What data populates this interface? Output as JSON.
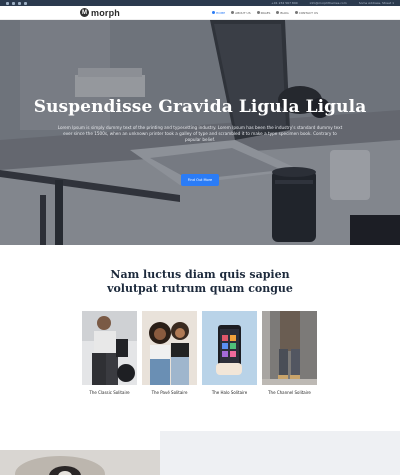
{
  "topbar": {
    "phone": "+01 234 567 890",
    "email": "info@morphthemes.com",
    "address": "Some Address, Street 1"
  },
  "brand": {
    "name": "morph",
    "mark": "M"
  },
  "nav": {
    "items": [
      {
        "label": "HOME",
        "active": true
      },
      {
        "label": "ABOUT US",
        "active": false
      },
      {
        "label": "PAGES",
        "active": false
      },
      {
        "label": "BLOG",
        "active": false
      },
      {
        "label": "CONTACT US",
        "active": false
      }
    ]
  },
  "hero": {
    "title": "Suspendisse Gravida Ligula Ligula",
    "text": "Lorem Ipsum is simply dummy text of the printing and typesetting industry. Lorem Ipsum has been the industry's standard dummy text ever since the 1500s, when an unknown printer took a galley of type and scrambled it to make a type specimen book. Contrary to popular belief.",
    "button": "Find Out More"
  },
  "section": {
    "title_line1": "Nam luctus diam quis sapien",
    "title_line2": "volutpat rutrum quam congue"
  },
  "products": [
    {
      "name": "The Classic Solitaire"
    },
    {
      "name": "The Pavé Solitaire"
    },
    {
      "name": "The Halo Solitaire"
    },
    {
      "name": "The Channel Solitaire"
    }
  ],
  "colors": {
    "accent": "#2b7cf6",
    "topbar": "#2b3a4e",
    "heading": "#1d2a3c"
  }
}
